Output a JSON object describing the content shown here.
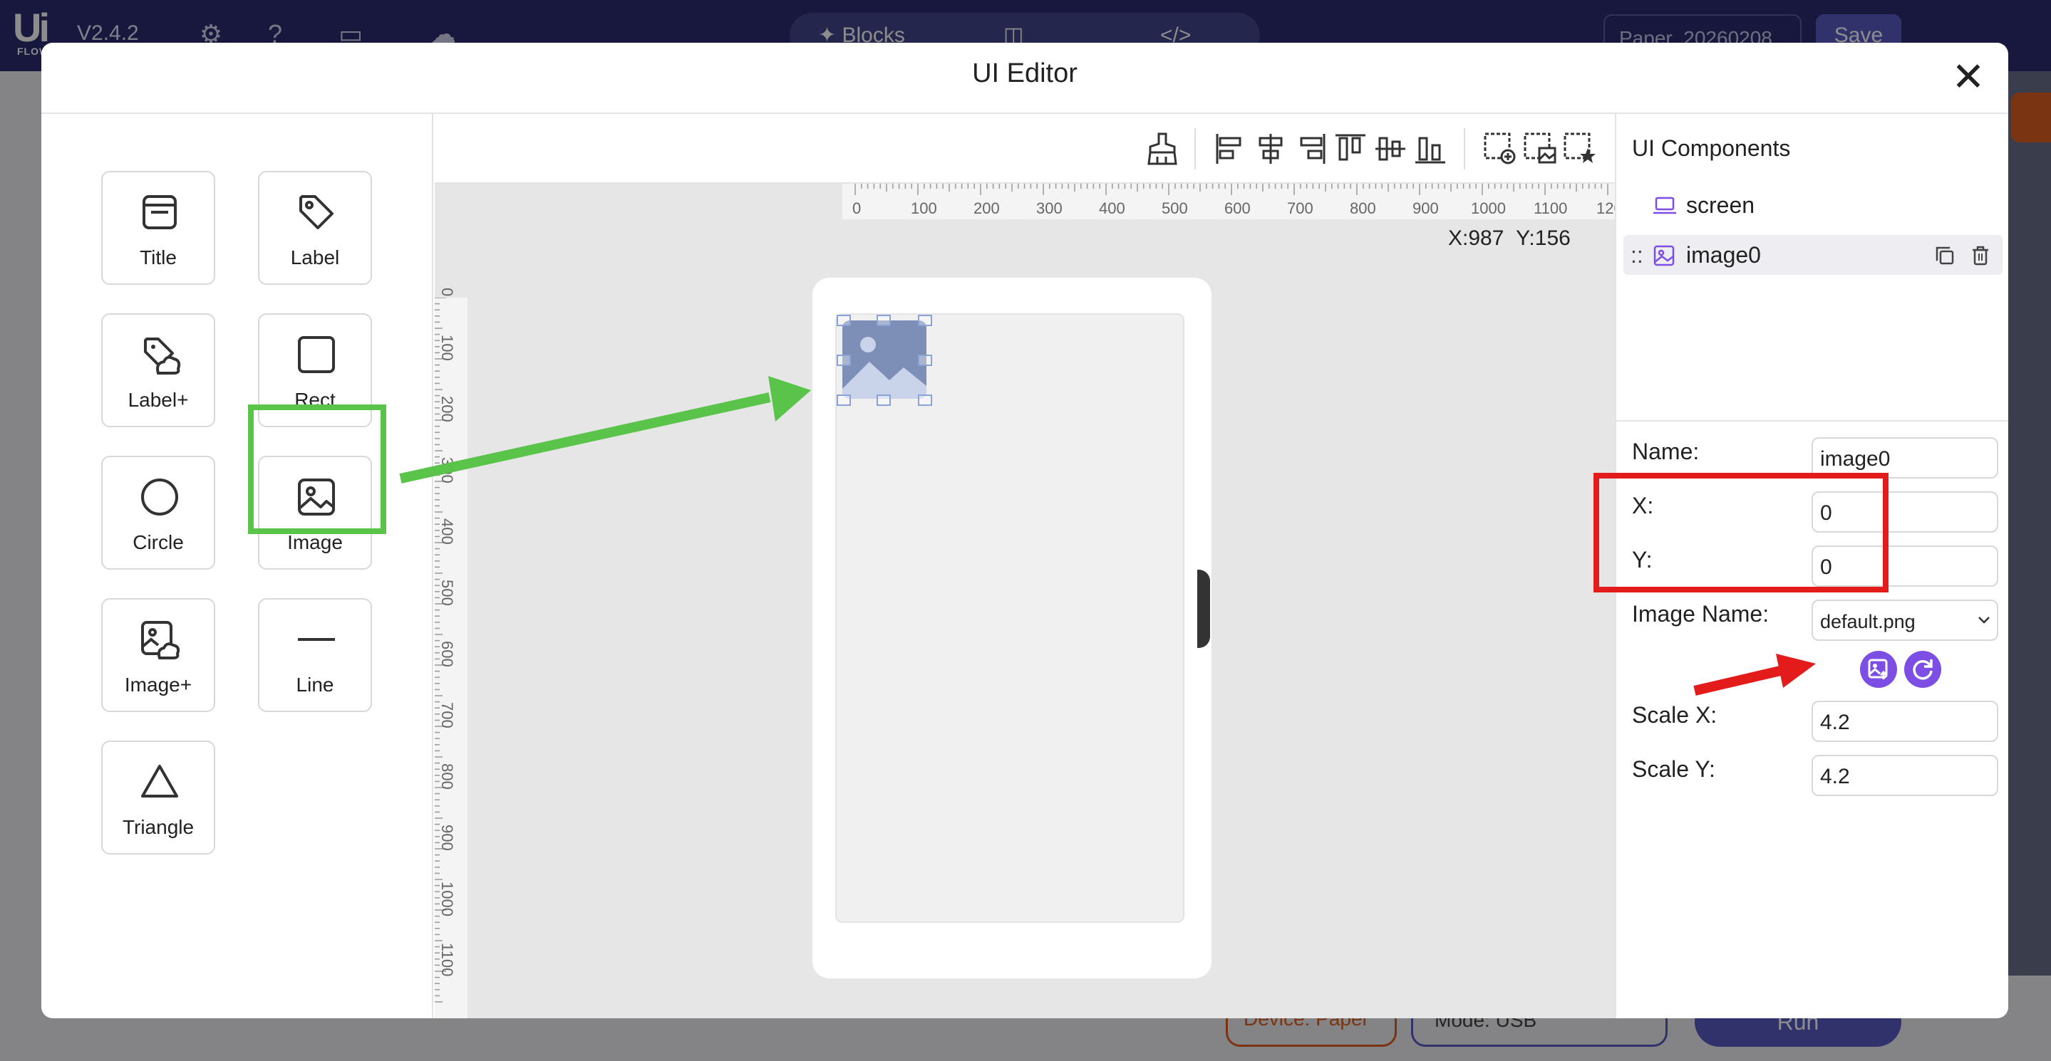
{
  "app": {
    "logo": "Ui",
    "logo_sub": "FLOW",
    "version": "V2.4.2",
    "tabs": [
      "Blocks",
      "",
      "</>"
    ],
    "filename": "Paper_20260208",
    "save_label": "Save",
    "device_label": "Device: Paper",
    "mode_label": "Mode: USB",
    "run_label": "Run"
  },
  "dialog": {
    "title": "UI Editor",
    "close_icon": "close-icon"
  },
  "palette": {
    "items": [
      {
        "label": "Title",
        "icon": "title-icon"
      },
      {
        "label": "Label",
        "icon": "tag-icon"
      },
      {
        "label": "Label+",
        "icon": "label-plus-icon"
      },
      {
        "label": "Rect",
        "icon": "rect-icon"
      },
      {
        "label": "Circle",
        "icon": "circle-icon"
      },
      {
        "label": "Image",
        "icon": "image-icon"
      },
      {
        "label": "Image+",
        "icon": "image-plus-icon"
      },
      {
        "label": "Line",
        "icon": "line-icon"
      },
      {
        "label": "Triangle",
        "icon": "triangle-icon"
      }
    ]
  },
  "canvas": {
    "ruler_h": [
      "0",
      "100",
      "200",
      "300",
      "400",
      "500",
      "600",
      "700",
      "800",
      "900",
      "1000",
      "1100",
      "120"
    ],
    "ruler_v": [
      "0",
      "100",
      "200",
      "300",
      "400",
      "500",
      "600",
      "700",
      "800",
      "900",
      "1000",
      "1100"
    ],
    "coord_x": "X:987",
    "coord_y": "Y:156"
  },
  "components": {
    "title": "UI Components",
    "tree": [
      {
        "name": "screen",
        "icon": "laptop-icon"
      },
      {
        "name": "image0",
        "icon": "image-icon",
        "drag": "::"
      }
    ]
  },
  "properties": {
    "name_label": "Name:",
    "name_value": "image0",
    "x_label": "X:",
    "x_value": "0",
    "y_label": "Y:",
    "y_value": "0",
    "image_name_label": "Image Name:",
    "image_name_value": "default.png",
    "scale_x_label": "Scale X:",
    "scale_x_value": "4.2",
    "scale_y_label": "Scale Y:",
    "scale_y_value": "4.2"
  },
  "colors": {
    "accent": "#7c4ee4",
    "highlight_green": "#5ac34a",
    "highlight_red": "#e41b1b"
  }
}
